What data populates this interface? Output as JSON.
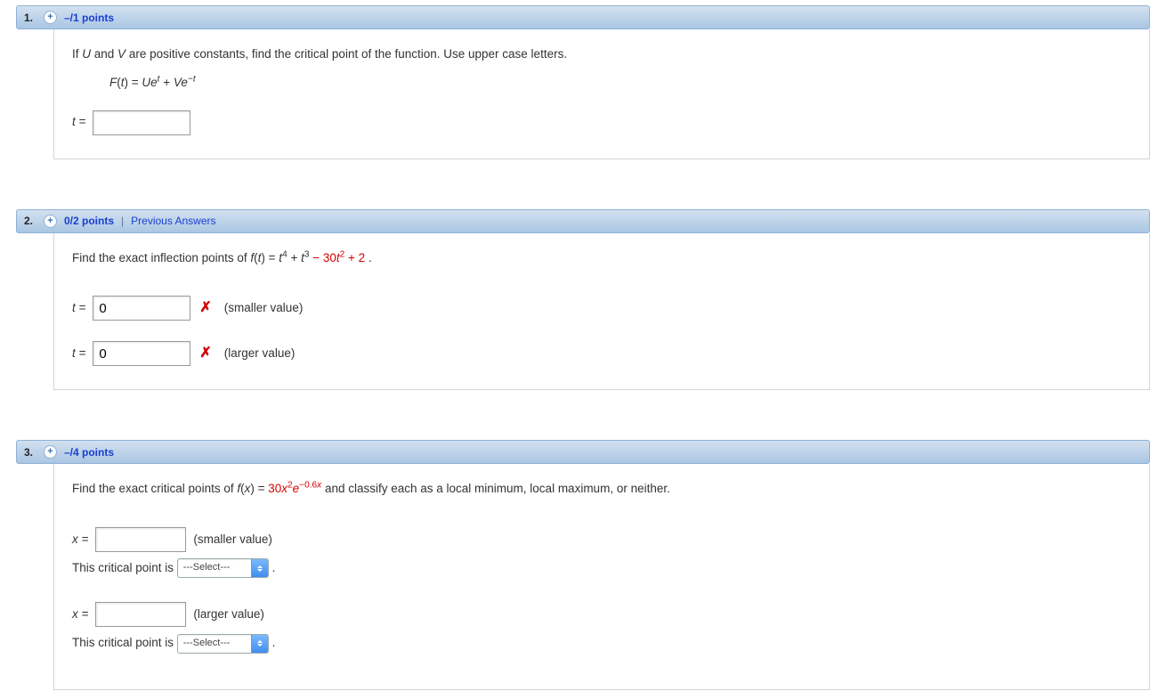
{
  "q1": {
    "num": "1.",
    "points": "–/1 points",
    "prompt_pre": "If ",
    "prompt_u": "U",
    "prompt_and": " and ",
    "prompt_v": "V",
    "prompt_post": " are positive constants, find the critical point of the function. Use upper case letters.",
    "formula": {
      "F": "F",
      "t": "t",
      "eq": " = ",
      "U": "U",
      "e": "e",
      "plus": " + ",
      "V": "V",
      "neg": "−",
      "t_sup": "t",
      "neg_t": "−t"
    },
    "label_t": "t ="
  },
  "q2": {
    "num": "2.",
    "points": "0/2 points",
    "prev": "Previous Answers",
    "prompt_pre": "Find the exact inflection points of  ",
    "fn": {
      "f": "f",
      "t": "t",
      "eq": " = ",
      "t_var": "t",
      "p4": "4",
      "plus1": " + ",
      "p3": "3",
      "minus": " − ",
      "coef30": "30",
      "p2": "2",
      "plus2": " + ",
      "c2": "2",
      "dot": " ."
    },
    "label_t": "t =",
    "val1": "0",
    "val2": "0",
    "smaller": "(smaller value)",
    "larger": "(larger value)"
  },
  "q3": {
    "num": "3.",
    "points": "–/4 points",
    "prompt_pre": "Find the exact critical points of  ",
    "fn": {
      "f": "f",
      "x": "x",
      "eq": " = ",
      "coef": "30",
      "xvar": "x",
      "p2": "2",
      "e": "e",
      "exp": "−0.6",
      "expx": "x"
    },
    "prompt_post": "  and classify each as a local minimum, local maximum, or neither.",
    "label_x": "x =",
    "smaller": "(smaller value)",
    "larger": "(larger value)",
    "sentence": "This critical point is ",
    "select": "---Select---",
    "dot": " ."
  }
}
